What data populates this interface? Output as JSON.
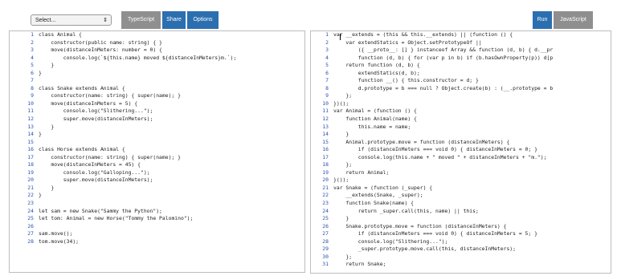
{
  "toolbar": {
    "select_label": "Select...",
    "typescript_label": "TypeScript",
    "share_label": "Share",
    "options_label": "Options",
    "run_label": "Run",
    "javascript_label": "JavaScript"
  },
  "left_code": [
    "class Animal {",
    "    constructor(public name: string) { }",
    "    move(distanceInMeters: number = 0) {",
    "        console.log(`${this.name} moved ${distanceInMeters}m.`);",
    "    }",
    "}",
    "",
    "class Snake extends Animal {",
    "    constructor(name: string) { super(name); }",
    "    move(distanceInMeters = 5) {",
    "        console.log(\"Slithering...\");",
    "        super.move(distanceInMeters);",
    "    }",
    "}",
    "",
    "class Horse extends Animal {",
    "    constructor(name: string) { super(name); }",
    "    move(distanceInMeters = 45) {",
    "        console.log(\"Galloping...\");",
    "        super.move(distanceInMeters);",
    "    }",
    "}",
    "",
    "let sam = new Snake(\"Sammy the Python\");",
    "let tom: Animal = new Horse(\"Tommy the Palomino\");",
    "",
    "sam.move();",
    "tom.move(34);"
  ],
  "right_code": [
    "var __extends = (this && this.__extends) || (function () {",
    "    var extendStatics = Object.setPrototypeOf ||",
    "        ({ __proto__: [] } instanceof Array && function (d, b) { d.__pr",
    "        function (d, b) { for (var p in b) if (b.hasOwnProperty(p)) d[p",
    "    return function (d, b) {",
    "        extendStatics(d, b);",
    "        function __() { this.constructor = d; }",
    "        d.prototype = b === null ? Object.create(b) : (__.prototype = b",
    "    };",
    "})();",
    "var Animal = (function () {",
    "    function Animal(name) {",
    "        this.name = name;",
    "    }",
    "    Animal.prototype.move = function (distanceInMeters) {",
    "        if (distanceInMeters === void 0) { distanceInMeters = 0; }",
    "        console.log(this.name + \" moved \" + distanceInMeters + \"m.\");",
    "    };",
    "    return Animal;",
    "}());",
    "var Snake = (function (_super) {",
    "    __extends(Snake, _super);",
    "    function Snake(name) {",
    "        return _super.call(this, name) || this;",
    "    }",
    "    Snake.prototype.move = function (distanceInMeters) {",
    "        if (distanceInMeters === void 0) { distanceInMeters = 5; }",
    "        console.log(\"Slithering...\");",
    "        _super.prototype.move.call(this, distanceInMeters);",
    "    };",
    "    return Snake;"
  ]
}
